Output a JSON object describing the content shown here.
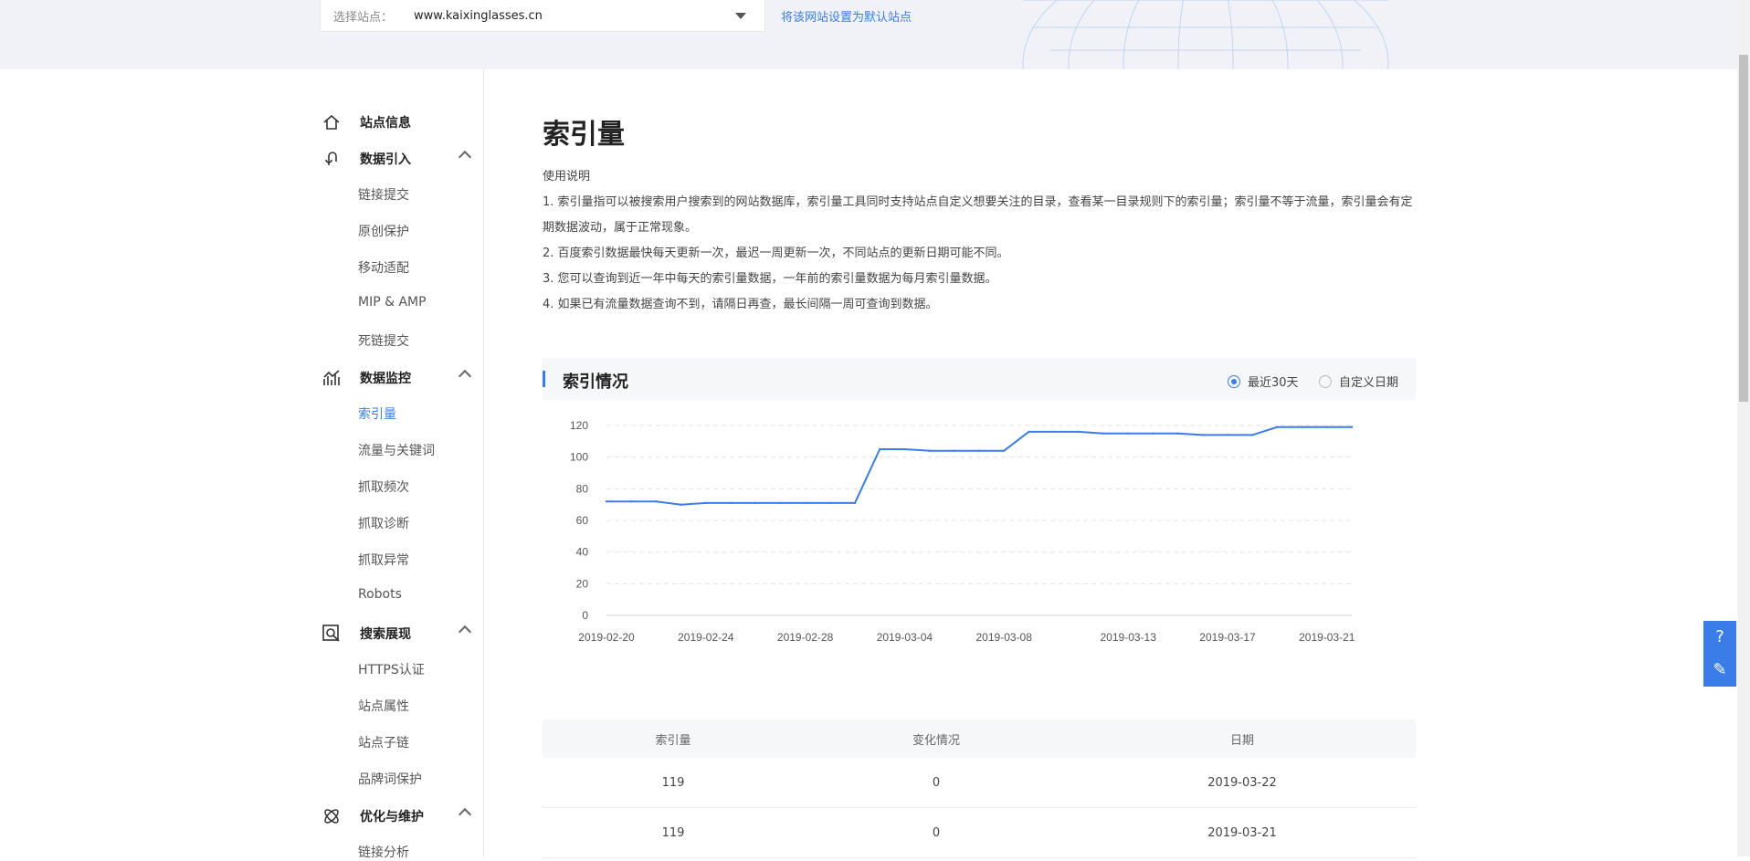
{
  "header": {
    "select_label": "选择站点：",
    "site": "www.kaixinglasses.cn",
    "default_link": "将该网站设置为默认站点"
  },
  "sidebar": {
    "groups": [
      {
        "title": "站点信息",
        "icon": "home-icon"
      },
      {
        "title": "数据引入",
        "icon": "data-import-icon",
        "items": [
          "链接提交",
          "原创保护",
          "移动适配",
          "MIP & AMP",
          "死链提交"
        ]
      },
      {
        "title": "数据监控",
        "icon": "chart-monitor-icon",
        "items": [
          "索引量",
          "流量与关键词",
          "抓取频次",
          "抓取诊断",
          "抓取异常",
          "Robots"
        ]
      },
      {
        "title": "搜索展现",
        "icon": "search-display-icon",
        "items": [
          "HTTPS认证",
          "站点属性",
          "站点子链",
          "品牌词保护"
        ]
      },
      {
        "title": "优化与维护",
        "icon": "optimize-icon",
        "items": [
          "链接分析"
        ]
      }
    ],
    "active": "索引量"
  },
  "main": {
    "title": "索引量",
    "usage_title": "使用说明",
    "usage": [
      "1. 索引量指可以被搜索用户搜索到的网站数据库，索引量工具同时支持站点自定义想要关注的目录，查看某一目录规则下的索引量；索引量不等于流量，索引量会有定期数据波动，属于正常现象。",
      "2. 百度索引数据最快每天更新一次，最迟一周更新一次，不同站点的更新日期可能不同。",
      "3. 您可以查询到近一年中每天的索引量数据，一年前的索引量数据为每月索引量数据。",
      "4. 如果已有流量数据查询不到，请隔日再查，最长间隔一周可查询到数据。"
    ],
    "section_title": "索引情况",
    "radio_recent": "最近30天",
    "radio_custom": "自定义日期"
  },
  "chart_data": {
    "type": "line",
    "title": "",
    "xlabel": "",
    "ylabel": "",
    "ylim": [
      0,
      120
    ],
    "yticks": [
      0,
      20,
      40,
      60,
      80,
      100,
      120
    ],
    "xticks": [
      "2019-02-20",
      "2019-02-24",
      "2019-02-28",
      "2019-03-04",
      "2019-03-08",
      "2019-03-13",
      "2019-03-17",
      "2019-03-21"
    ],
    "x": [
      "2019-02-20",
      "2019-02-21",
      "2019-02-22",
      "2019-02-23",
      "2019-02-24",
      "2019-02-25",
      "2019-02-26",
      "2019-02-27",
      "2019-02-28",
      "2019-03-01",
      "2019-03-02",
      "2019-03-03",
      "2019-03-04",
      "2019-03-05",
      "2019-03-06",
      "2019-03-07",
      "2019-03-08",
      "2019-03-09",
      "2019-03-10",
      "2019-03-11",
      "2019-03-12",
      "2019-03-13",
      "2019-03-14",
      "2019-03-15",
      "2019-03-16",
      "2019-03-17",
      "2019-03-18",
      "2019-03-19",
      "2019-03-20",
      "2019-03-21",
      "2019-03-22"
    ],
    "series": [
      {
        "values": [
          72,
          72,
          72,
          70,
          71,
          71,
          71,
          71,
          71,
          71,
          71,
          105,
          105,
          104,
          104,
          104,
          104,
          116,
          116,
          116,
          115,
          115,
          115,
          115,
          114,
          114,
          114,
          119,
          119,
          119,
          119
        ],
        "color": "#3b7de8"
      }
    ],
    "grid": true
  },
  "table": {
    "headers": [
      "索引量",
      "变化情况",
      "日期"
    ],
    "rows": [
      [
        "119",
        "0",
        "2019-03-22"
      ],
      [
        "119",
        "0",
        "2019-03-21"
      ]
    ]
  },
  "float_tools": {
    "help_icon": "help-icon",
    "feedback_icon": "feedback-icon"
  }
}
